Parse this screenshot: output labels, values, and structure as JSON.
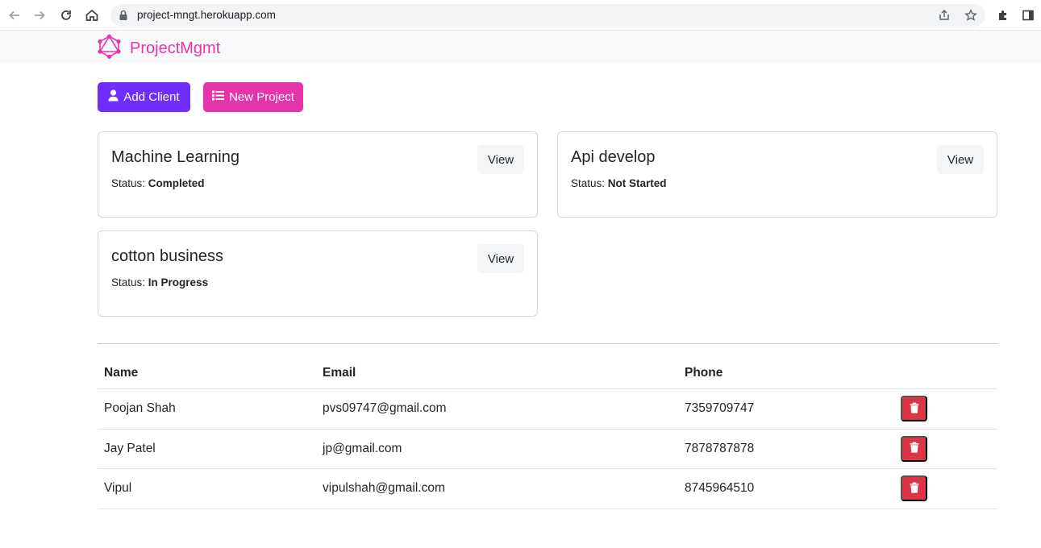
{
  "browser": {
    "url": "project-mngt.herokuapp.com"
  },
  "navbar": {
    "brand": "ProjectMgmt",
    "brand_color": "#e535ab"
  },
  "actions": {
    "add_client_label": "Add Client",
    "new_project_label": "New Project",
    "add_client_color": "#6f2dfe",
    "new_project_color": "#e535ab"
  },
  "projects": [
    {
      "name": "Machine Learning",
      "status_label": "Status:",
      "status": "Completed",
      "view_label": "View"
    },
    {
      "name": "Api develop",
      "status_label": "Status:",
      "status": "Not Started",
      "view_label": "View"
    },
    {
      "name": "cotton business",
      "status_label": "Status:",
      "status": "In Progress",
      "view_label": "View"
    }
  ],
  "clients": {
    "headers": {
      "name": "Name",
      "email": "Email",
      "phone": "Phone"
    },
    "rows": [
      {
        "name": "Poojan Shah",
        "email": "pvs09747@gmail.com",
        "phone": "7359709747"
      },
      {
        "name": "Jay Patel",
        "email": "jp@gmail.com",
        "phone": "7878787878"
      },
      {
        "name": "Vipul",
        "email": "vipulshah@gmail.com",
        "phone": "8745964510"
      }
    ],
    "delete_icon": "trash-icon",
    "delete_color": "#dc3545"
  }
}
